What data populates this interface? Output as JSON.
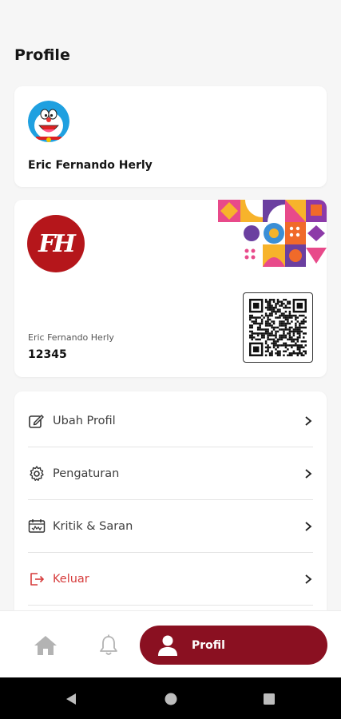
{
  "header": {
    "title": "Profile"
  },
  "profile": {
    "name": "Eric Fernando Herly"
  },
  "member_card": {
    "logo_text": "FH",
    "name": "Eric Fernando Herly",
    "id": "12345"
  },
  "menu": {
    "items": [
      {
        "label": "Ubah Profil",
        "icon": "edit-icon"
      },
      {
        "label": "Pengaturan",
        "icon": "gear-icon"
      },
      {
        "label": "Kritik & Saran",
        "icon": "feedback-icon"
      },
      {
        "label": "Keluar",
        "icon": "logout-icon"
      }
    ]
  },
  "bottom_nav": {
    "profile_label": "Profil",
    "active": "profile"
  },
  "colors": {
    "brand": "#8a1021",
    "logo_red": "#b5161b",
    "logout": "#d63b3b"
  }
}
